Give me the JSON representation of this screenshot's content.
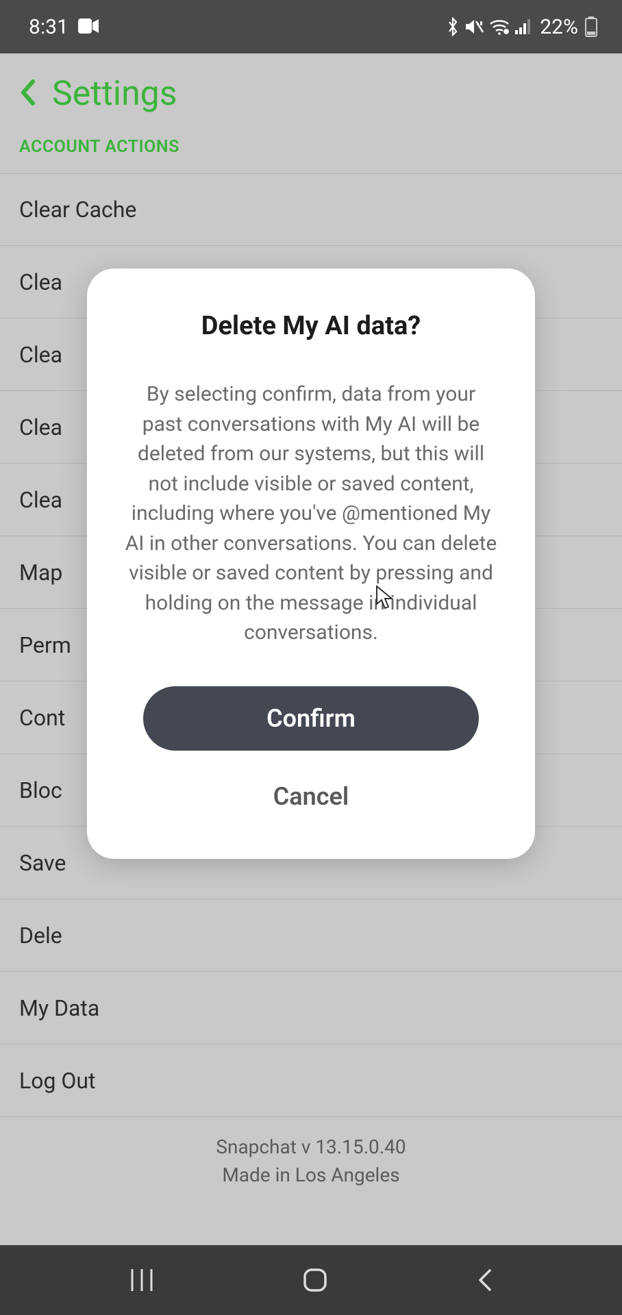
{
  "status": {
    "time": "8:31",
    "battery_pct": "22%"
  },
  "header": {
    "title": "Settings"
  },
  "section_label": "ACCOUNT ACTIONS",
  "items": [
    {
      "label": "Clear Cache"
    },
    {
      "label": "Clea"
    },
    {
      "label": "Clea"
    },
    {
      "label": "Clea"
    },
    {
      "label": "Clea"
    },
    {
      "label": "Map"
    },
    {
      "label": "Perm"
    },
    {
      "label": "Cont"
    },
    {
      "label": "Bloc"
    },
    {
      "label": "Save"
    },
    {
      "label": "Dele"
    },
    {
      "label": "My Data"
    },
    {
      "label": "Log Out"
    }
  ],
  "footer": {
    "line1": "Snapchat v 13.15.0.40",
    "line2": "Made in Los Angeles"
  },
  "modal": {
    "title": "Delete My AI data?",
    "body": "By selecting confirm, data from your past conversations with My AI will be deleted from our systems, but this will not include visible or saved content, including where you've @mentioned My AI in other conversations. You can delete visible or saved content by pressing and holding on the message in individual conversations.",
    "confirm": "Confirm",
    "cancel": "Cancel"
  }
}
